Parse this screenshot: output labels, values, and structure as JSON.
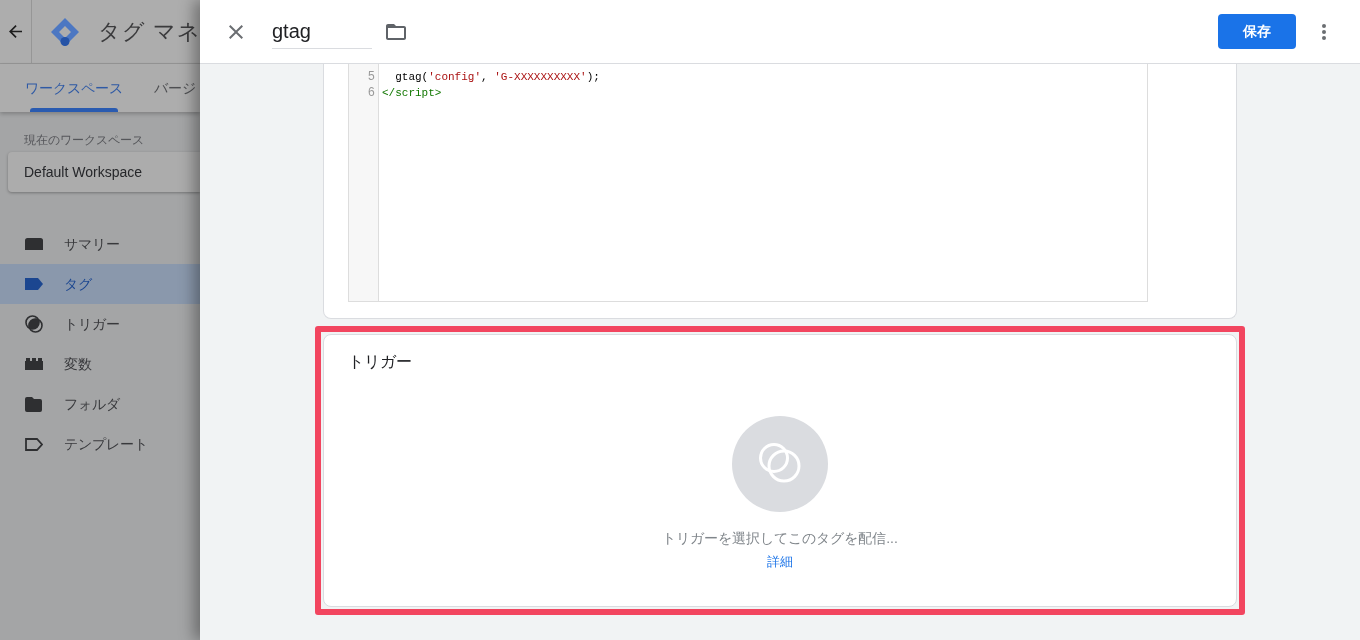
{
  "app_header": {
    "title": "タグ マネ"
  },
  "tabs": [
    {
      "label": "ワークスペース",
      "selected": true
    },
    {
      "label": "バージ",
      "selected": false
    }
  ],
  "workspace": {
    "label": "現在のワークスペース",
    "name": "Default Workspace"
  },
  "sidebar": {
    "items": [
      {
        "label": "サマリー",
        "kind": "summary",
        "selected": false
      },
      {
        "label": "タグ",
        "kind": "tag",
        "selected": true
      },
      {
        "label": "トリガー",
        "kind": "trigger",
        "selected": false
      },
      {
        "label": "変数",
        "kind": "variable",
        "selected": false
      },
      {
        "label": "フォルダ",
        "kind": "folder",
        "selected": false
      },
      {
        "label": "テンプレート",
        "kind": "template",
        "selected": false
      }
    ]
  },
  "tag_editor": {
    "name": "gtag",
    "save_button": "保存"
  },
  "code": {
    "lines": [
      {
        "number": "5",
        "tokens": [
          {
            "kind": "plain",
            "text": "  gtag("
          },
          {
            "kind": "string",
            "text": "'config'"
          },
          {
            "kind": "plain",
            "text": ", "
          },
          {
            "kind": "string",
            "text": "'G-XXXXXXXXXX'"
          },
          {
            "kind": "plain",
            "text": ");"
          }
        ]
      },
      {
        "number": "6",
        "tokens": [
          {
            "kind": "tag",
            "text": "</script>"
          }
        ]
      }
    ]
  },
  "trigger_section": {
    "title": "トリガー",
    "highlighted": true,
    "hint": "トリガーを選択してこのタグを配信...",
    "link": "詳細"
  }
}
